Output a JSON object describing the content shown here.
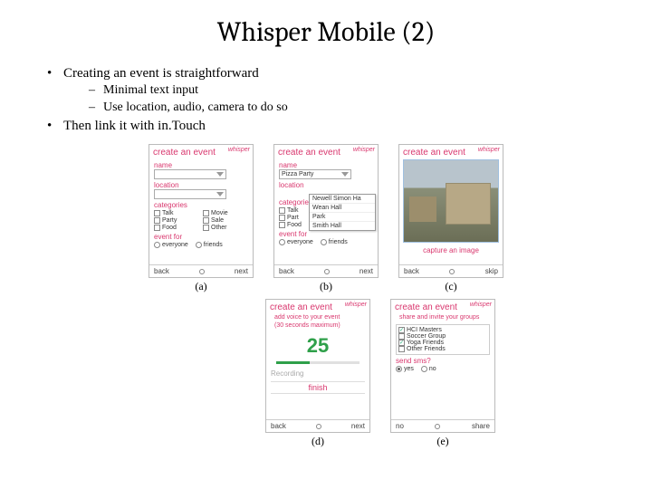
{
  "title": "Whisper Mobile (2)",
  "bullets": {
    "b1": "Creating an event is straightforward",
    "s1": "Minimal text input",
    "s2": "Use location, audio, camera to do so",
    "b2": "Then link it with in.Touch"
  },
  "brand": "whisper",
  "captions": {
    "a": "(a)",
    "b": "(b)",
    "c": "(c)",
    "d": "(d)",
    "e": "(e)"
  },
  "common": {
    "title": "create an event",
    "name_l": "name",
    "location_l": "location",
    "categories_l": "categories",
    "eventfor_l": "event for",
    "radio_everyone": "everyone",
    "radio_friends": "friends",
    "foot_back": "back",
    "foot_next": "next",
    "foot_skip": "skip",
    "foot_no": "no",
    "foot_share": "share"
  },
  "a": {
    "cats": [
      "Talk",
      "Movie",
      "Party",
      "Sale",
      "Food",
      "Other"
    ]
  },
  "b": {
    "name_val": "Pizza Party",
    "popup": [
      "Newell Simon Ha",
      "Wean Hall",
      "Park",
      "Smith Hall"
    ],
    "cats": [
      "Talk",
      "Part",
      "Food"
    ]
  },
  "c": {
    "caption": "capture an image"
  },
  "d": {
    "sub1": "add voice to your event",
    "sub2": "(30 seconds maximum)",
    "count": "25",
    "rec": "Recording",
    "finish": "finish"
  },
  "e": {
    "sub": "share and invite your groups",
    "groups": [
      "HCI Masters",
      "Soccer Group",
      "Yoga Friends",
      "Other Friends"
    ],
    "sms_l": "send sms?",
    "yes": "yes",
    "no": "no"
  }
}
